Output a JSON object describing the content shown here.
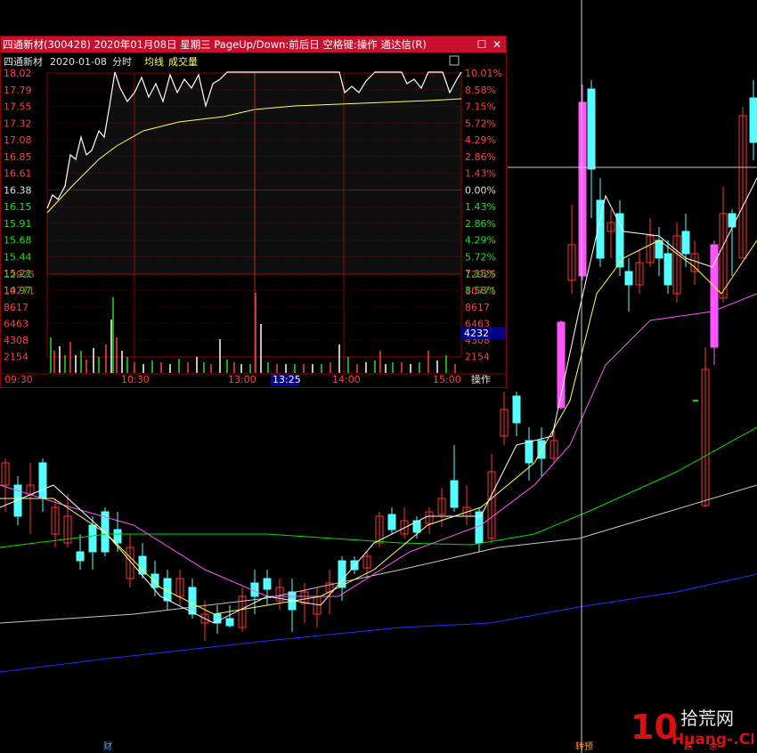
{
  "window": {
    "title": "四通新材(300428) 2020年01月08日 星期三 PageUp/Down:前后日 空格键:操作 通达信(R)",
    "restore_glyph": "☐",
    "close_glyph": "✕"
  },
  "minute_chart": {
    "header": {
      "stock_name": "四通新材",
      "date": "2020-01-08",
      "chart_type": "分时",
      "avg_label": "均线",
      "volume_label": "成交量"
    },
    "prev_close": 16.38,
    "price_labels_left": [
      "18.02",
      "17.79",
      "17.55",
      "17.32",
      "17.08",
      "16.85",
      "16.61",
      "16.38",
      "16.15",
      "15.91",
      "15.68",
      "15.44",
      "15.21",
      "14.97"
    ],
    "pct_labels_right": [
      "10.01%",
      "8.58%",
      "7.15%",
      "5.72%",
      "4.29%",
      "2.86%",
      "1.43%",
      "0.00%",
      "1.43%",
      "2.86%",
      "4.29%",
      "5.72%",
      "7.15%",
      "8.58%"
    ],
    "volume_labels": [
      "12925",
      "10771",
      "8617",
      "6463",
      "4308",
      "2154"
    ],
    "volume_cursor_value": "4232",
    "time_labels": [
      "09:30",
      "10:30",
      "13:00",
      "14:00",
      "15:00"
    ],
    "cursor_time": "13:25",
    "action_button": "操作"
  },
  "kline_chart": {
    "crosshair_price_row": "0.00%",
    "bottom_markers": [
      {
        "text": "财",
        "color": "#5aa0ff"
      },
      {
        "text": "转预",
        "color": "#ff9a30"
      },
      {
        "text": "跌",
        "color": "#ff3b3b"
      },
      {
        "text": "余",
        "color": "#ff3b3b"
      }
    ]
  },
  "watermark": {
    "logo_text": "10",
    "site_text": "拾荒网",
    "domain": "Huang-.CN"
  },
  "colors": {
    "up_candle": "#ff3232",
    "down_candle": "#54ffff",
    "limit_candle": "#ff54ff",
    "ma5": "#ffffff",
    "ma10": "#ffff54",
    "ma20": "#ff54ff",
    "ma60": "#00e000",
    "ma120": "#c8c8c8",
    "ma250": "#2030ff",
    "title_bar": "#c8102e",
    "grid": "#8a0000"
  }
}
